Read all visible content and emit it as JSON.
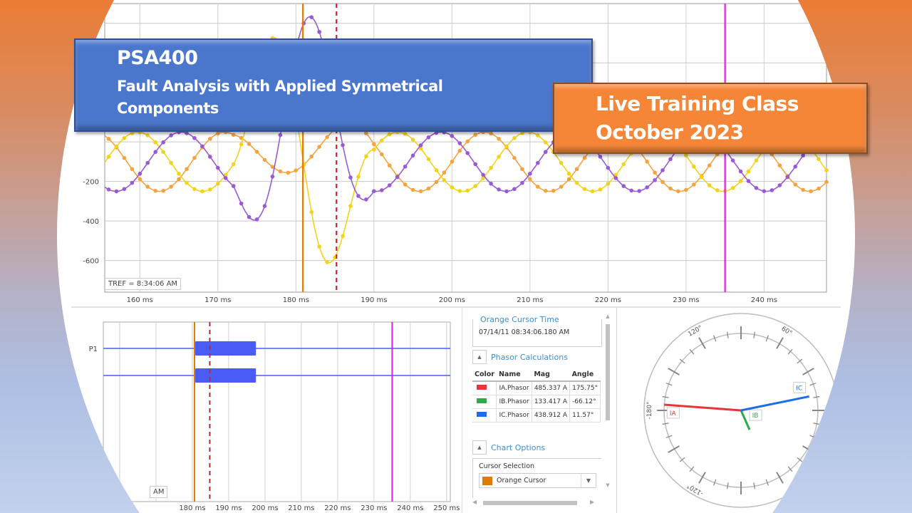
{
  "banners": {
    "course_code": "PSA400",
    "course_title": "Fault Analysis with Applied Symmetrical Components",
    "class_type": "Live Training Class",
    "class_date": "October 2023"
  },
  "colors": {
    "orange_cursor": "#e07b00",
    "reference_cursor": "#c0282d",
    "magenta_cursor": "#e81ce8",
    "wave_orange": "#f5a340",
    "wave_yellow": "#f3d31a",
    "wave_purple": "#9a5ad4",
    "ia": "#e8353a",
    "ib": "#2ea84a",
    "ic": "#1a6ee8",
    "digital": "#4a5cf5"
  },
  "chart_data": [
    {
      "type": "line",
      "name": "waveform-chart",
      "xlabel": "",
      "ylabel": "",
      "x_unit": "ms",
      "xlim": [
        155.5,
        248
      ],
      "ylim": [
        -760,
        700
      ],
      "x_ticks": [
        "160 ms",
        "170 ms",
        "180 ms",
        "190 ms",
        "200 ms",
        "210 ms",
        "220 ms",
        "230 ms",
        "240 ms"
      ],
      "x_tick_values": [
        160,
        170,
        180,
        190,
        200,
        210,
        220,
        230,
        240
      ],
      "y_ticks": [
        "-200",
        "-400",
        "-600"
      ],
      "y_tick_values": [
        -200,
        -400,
        -600
      ],
      "y_gridlines": [
        600,
        400,
        200,
        0,
        -200,
        -400,
        -600
      ],
      "tref_label": "TREF = 8:34:06 AM",
      "cursors": [
        {
          "name": "orange-cursor",
          "x": 180.9,
          "style": "solid"
        },
        {
          "name": "reference-cursor",
          "x": 185.2,
          "style": "dashed"
        },
        {
          "name": "magenta-cursor",
          "x": 235.0,
          "style": "solid"
        }
      ],
      "series": [
        {
          "name": "phase-orange",
          "color_key": "wave_orange",
          "prefault_amp": 150,
          "prefault_offset": -100,
          "phase_deg": 0,
          "fault_amp": 150
        },
        {
          "name": "phase-yellow",
          "color_key": "wave_yellow",
          "prefault_amp": 150,
          "prefault_offset": -100,
          "phase_deg": -120,
          "fault_amp": 690
        },
        {
          "name": "phase-purple",
          "color_key": "wave_purple",
          "prefault_amp": 150,
          "prefault_offset": -100,
          "phase_deg": 120,
          "fault_amp": 640
        }
      ]
    },
    {
      "type": "bar",
      "name": "digital-chart",
      "x_ticks": [
        "180 ms",
        "190 ms",
        "200 ms",
        "210 ms",
        "220 ms",
        "230 ms",
        "240 ms",
        "250 ms"
      ],
      "x_tick_values": [
        180,
        190,
        200,
        210,
        220,
        230,
        240,
        250
      ],
      "xlim": [
        155.5,
        251
      ],
      "channels": [
        {
          "label": "P1",
          "on_start": 180.8,
          "on_end": 197.5
        },
        {
          "label": "",
          "on_start": 180.8,
          "on_end": 197.5
        }
      ],
      "cursors": [
        {
          "name": "orange-cursor",
          "x": 180.6,
          "style": "solid"
        },
        {
          "name": "reference-cursor",
          "x": 184.8,
          "style": "dashed"
        },
        {
          "name": "magenta-cursor",
          "x": 235.0,
          "style": "solid"
        }
      ],
      "tref_label": "AM"
    },
    {
      "type": "scatter",
      "name": "phasor-diagram",
      "angle_labels": [
        "120°",
        "60°",
        "-180°",
        "-120°"
      ],
      "phasors": [
        {
          "label": "IA",
          "mag": 485.337,
          "angle": 175.75,
          "color_key": "ia"
        },
        {
          "label": "IB",
          "mag": 133.417,
          "angle": -66.12,
          "color_key": "ib"
        },
        {
          "label": "IC",
          "mag": 438.912,
          "angle": 11.57,
          "color_key": "ic"
        }
      ]
    }
  ],
  "side_panel": {
    "cursor_time_title": "Orange Cursor Time",
    "cursor_time_value": "07/14/11 08:34:06.180 AM",
    "phasor_section_label": "Phasor Calculations",
    "phasor_table": {
      "headers": [
        "Color",
        "Name",
        "Mag",
        "Angle"
      ],
      "rows": [
        {
          "color": "#e8353a",
          "name": "IA.Phasor",
          "mag": "485.337 A",
          "angle": "175.75°"
        },
        {
          "color": "#2ea84a",
          "name": "IB.Phasor",
          "mag": "133.417 A",
          "angle": "-66.12°"
        },
        {
          "color": "#1a6ee8",
          "name": "IC.Phasor",
          "mag": "438.912 A",
          "angle": "11.57°"
        }
      ]
    },
    "chart_options_label": "Chart Options",
    "cursor_selection_label": "Cursor Selection",
    "cursor_selection_value": "Orange Cursor"
  }
}
